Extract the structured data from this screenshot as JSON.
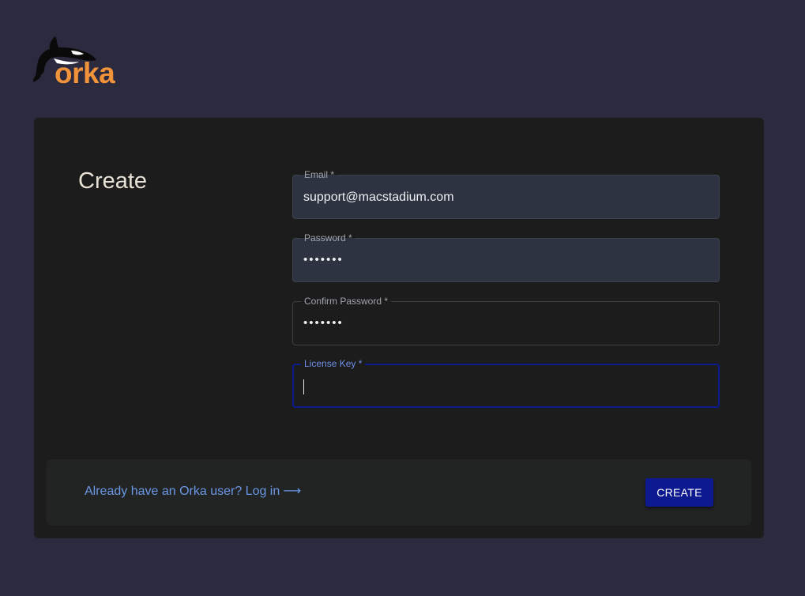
{
  "brand": {
    "name": "orka",
    "icon": "orca-whale-icon",
    "color": "#f0933a"
  },
  "form": {
    "title": "Create",
    "fields": [
      {
        "label": "Email *",
        "value": "support@macstadium.com",
        "type": "text"
      },
      {
        "label": "Password *",
        "value": "•••••••",
        "type": "password"
      },
      {
        "label": "Confirm Password *",
        "value": "•••••••",
        "type": "password"
      },
      {
        "label": "License Key *",
        "value": "",
        "type": "text"
      }
    ]
  },
  "footer": {
    "login_text": "Already have an Orka user? Log in",
    "login_arrow": "⟶",
    "create_label": "CREATE"
  },
  "colors": {
    "background": "#2b2a3e",
    "card": "#1c1c1c",
    "accent": "#0d1a8f",
    "link": "#6b98e6"
  }
}
